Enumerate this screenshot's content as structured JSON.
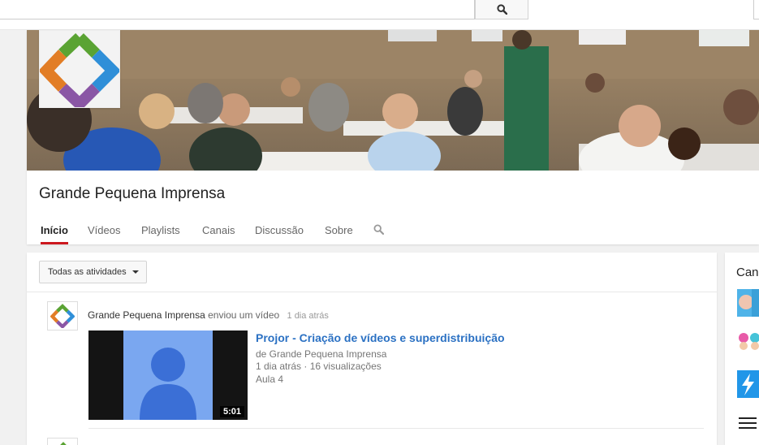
{
  "masthead": {
    "search_placeholder": "",
    "search_icon": "search-icon"
  },
  "channel": {
    "name": "Grande Pequena Imprensa",
    "tabs": [
      {
        "label": "Início",
        "active": true
      },
      {
        "label": "Vídeos",
        "active": false
      },
      {
        "label": "Playlists",
        "active": false
      },
      {
        "label": "Canais",
        "active": false
      },
      {
        "label": "Discussão",
        "active": false
      },
      {
        "label": "Sobre",
        "active": false
      }
    ],
    "tab_search_icon": "search-icon"
  },
  "feed": {
    "filter_label": "Todas as atividades",
    "item": {
      "author": "Grande Pequena Imprensa",
      "action": "enviou um vídeo",
      "time": "1 dia atrás",
      "video": {
        "title": "Projor - Criação de vídeos e superdistribuição",
        "byline": "de Grande Pequena Imprensa",
        "age": "1 dia atrás",
        "views": "16 visualizações",
        "description": "Aula 4",
        "duration": "5:01"
      }
    }
  },
  "sidebar": {
    "title": "Canais relacionados"
  },
  "colors": {
    "accent_red": "#cc181e",
    "link_blue": "#2b71c3",
    "logo_green": "#5aa333",
    "logo_blue": "#2f8fd8",
    "logo_purple": "#8a56a5",
    "logo_orange": "#e27d25"
  }
}
